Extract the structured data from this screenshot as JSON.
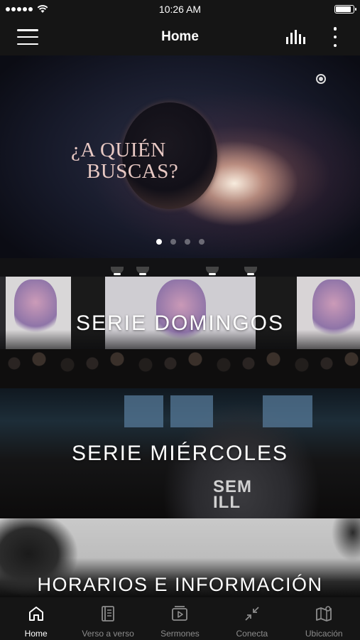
{
  "status_bar": {
    "time": "10:26 AM",
    "battery_level": 0.9
  },
  "nav": {
    "title": "Home"
  },
  "hero": {
    "title_line1": "¿A QUIÉN",
    "title_line2": "BUSCAS?",
    "page_count": 4,
    "active_page": 1
  },
  "cards": [
    {
      "label": "SERIE DOMINGOS"
    },
    {
      "label": "SERIE MIÉRCOLES",
      "shirt_text_1": "SEM",
      "shirt_text_2": "ILL"
    },
    {
      "label": "HORARIOS E INFORMACIÓN"
    }
  ],
  "tabs": [
    {
      "label": "Home",
      "icon": "home-icon",
      "active": true
    },
    {
      "label": "Verso a verso",
      "icon": "book-icon",
      "active": false
    },
    {
      "label": "Sermones",
      "icon": "video-icon",
      "active": false
    },
    {
      "label": "Conecta",
      "icon": "collapse-arrows-icon",
      "active": false
    },
    {
      "label": "Ubicación",
      "icon": "map-icon",
      "active": false
    }
  ],
  "colors": {
    "bar_background": "#151515",
    "tab_active": "#ffffff",
    "tab_inactive": "#8c8c8c"
  }
}
